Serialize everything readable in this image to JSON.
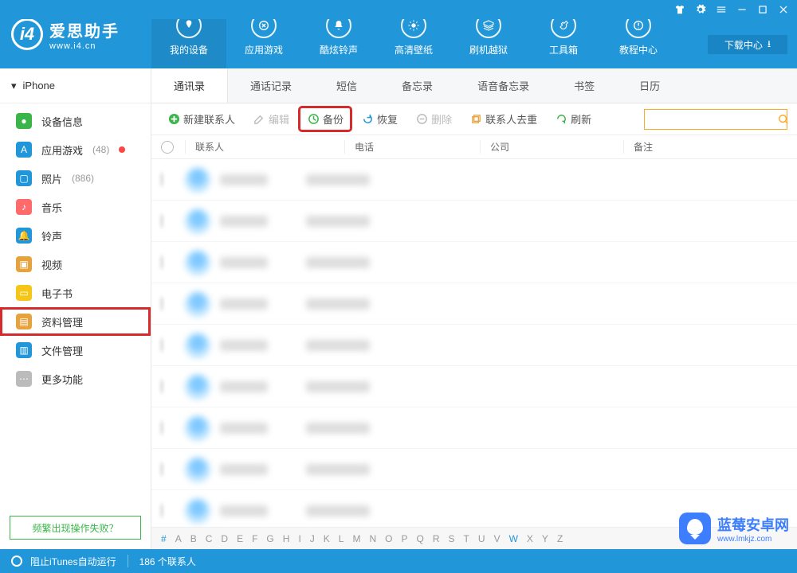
{
  "app": {
    "name_cn": "爱思助手",
    "name_en": "www.i4.cn"
  },
  "header": {
    "nav": [
      {
        "label": "我的设备"
      },
      {
        "label": "应用游戏"
      },
      {
        "label": "酷炫铃声"
      },
      {
        "label": "高清壁纸"
      },
      {
        "label": "刷机越狱"
      },
      {
        "label": "工具箱"
      },
      {
        "label": "教程中心"
      }
    ],
    "download_center": "下载中心"
  },
  "sidebar": {
    "device": "iPhone",
    "items": [
      {
        "label": "设备信息",
        "color": "#3bb54a",
        "badge": ""
      },
      {
        "label": "应用游戏",
        "color": "#2196d8",
        "badge": "(48)",
        "reddot": true
      },
      {
        "label": "照片",
        "color": "#2196d8",
        "badge": "(886)"
      },
      {
        "label": "音乐",
        "color": "#ff6b6b",
        "badge": ""
      },
      {
        "label": "铃声",
        "color": "#2196d8",
        "badge": ""
      },
      {
        "label": "视频",
        "color": "#e6a23c",
        "badge": ""
      },
      {
        "label": "电子书",
        "color": "#f5c518",
        "badge": ""
      },
      {
        "label": "资料管理",
        "color": "#e6a23c",
        "badge": "",
        "highlighted": true
      },
      {
        "label": "文件管理",
        "color": "#2196d8",
        "badge": ""
      },
      {
        "label": "更多功能",
        "color": "#bbb",
        "badge": ""
      }
    ],
    "help": "频繁出现操作失败？"
  },
  "tabs": [
    {
      "label": "通讯录",
      "active": true
    },
    {
      "label": "通话记录"
    },
    {
      "label": "短信"
    },
    {
      "label": "备忘录"
    },
    {
      "label": "语音备忘录"
    },
    {
      "label": "书签"
    },
    {
      "label": "日历"
    }
  ],
  "toolbar": {
    "new_contact": "新建联系人",
    "edit": "编辑",
    "backup": "备份",
    "restore": "恢复",
    "delete": "删除",
    "dedupe": "联系人去重",
    "refresh": "刷新",
    "search_placeholder": ""
  },
  "columns": {
    "contact": "联系人",
    "phone": "电话",
    "company": "公司",
    "note": "备注"
  },
  "letters": [
    "#",
    "A",
    "B",
    "C",
    "D",
    "E",
    "F",
    "G",
    "H",
    "I",
    "J",
    "K",
    "L",
    "M",
    "N",
    "O",
    "P",
    "Q",
    "R",
    "S",
    "T",
    "U",
    "V",
    "W",
    "X",
    "Y",
    "Z"
  ],
  "statusbar": {
    "itunes": "阻止iTunes自动运行",
    "count": "186 个联系人"
  },
  "watermark": {
    "cn": "蓝莓安卓网",
    "en": "www.lmkjz.com"
  },
  "rows_count": 9
}
